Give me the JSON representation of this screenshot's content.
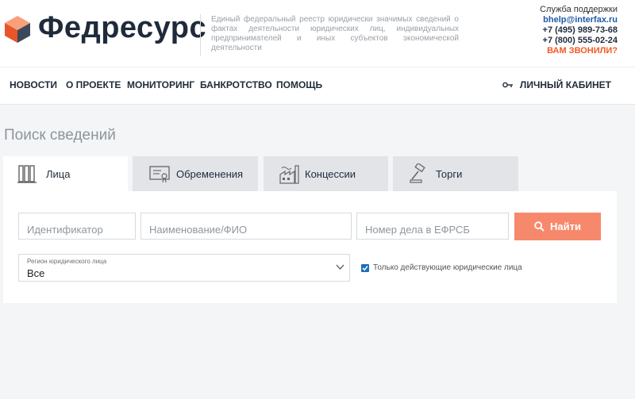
{
  "header": {
    "brand": "Федресурс",
    "tagline": "Единый федеральный реестр юридически значимых сведений о фактах деятельности юридических лиц, индивидуальных предпринимателей и иных субъектов экономической деятельности",
    "support": {
      "title": "Служба поддержки",
      "email": "bhelp@interfax.ru",
      "phone1": "+7 (495) 989-73-68",
      "phone2": "+7 (800) 555-02-24",
      "callback": "ВАМ ЗВОНИЛИ?"
    }
  },
  "nav": {
    "items": [
      "НОВОСТИ",
      "О ПРОЕКТЕ",
      "МОНИТОРИНГ",
      "БАНКРОТСТВО",
      "ПОМОЩЬ"
    ],
    "cabinet": "ЛИЧНЫЙ КАБИНЕТ"
  },
  "page": {
    "title": "Поиск сведений"
  },
  "tabs": [
    {
      "label": "Лица",
      "icon": "persons-icon",
      "active": true
    },
    {
      "label": "Обременения",
      "icon": "certificate-icon",
      "active": false
    },
    {
      "label": "Концессии",
      "icon": "factory-icon",
      "active": false
    },
    {
      "label": "Торги",
      "icon": "gavel-icon",
      "active": false
    }
  ],
  "search": {
    "identifier_placeholder": "Идентификатор",
    "name_placeholder": "Наименование/ФИО",
    "case_placeholder": "Номер дела в ЕФРСБ",
    "find_label": "Найти",
    "region_label": "Регион юридического лица",
    "region_value": "Все",
    "active_only_label": "Только действующие юридические лица",
    "active_only_checked": true
  },
  "colors": {
    "accent": "#f6896b",
    "brand_dark": "#1f2b3a",
    "link": "#1d5aa8",
    "alert": "#f15a24"
  }
}
